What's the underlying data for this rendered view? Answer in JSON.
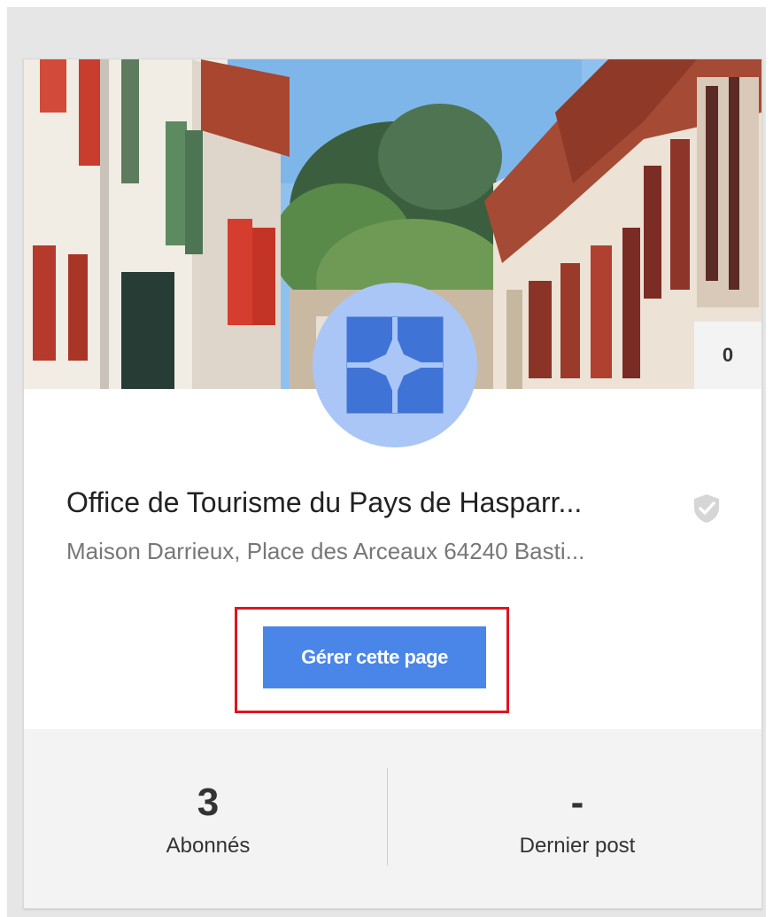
{
  "card": {
    "cover_badge_count": "0",
    "logo_icon": "star-tile-icon",
    "page_name": "Office de Tourisme du Pays de Hasparr...",
    "verified_icon": "shield-check-icon",
    "address": "Maison Darrieux, Place des Arceaux 64240 Basti...",
    "manage_button_label": "Gérer cette page",
    "highlight_color": "#e0141e",
    "button_color": "#4a86e8",
    "avatar_color": "#a9c6f7"
  },
  "stats": {
    "followers_value": "3",
    "followers_label": "Abonnés",
    "last_post_value": "-",
    "last_post_label": "Dernier post"
  }
}
